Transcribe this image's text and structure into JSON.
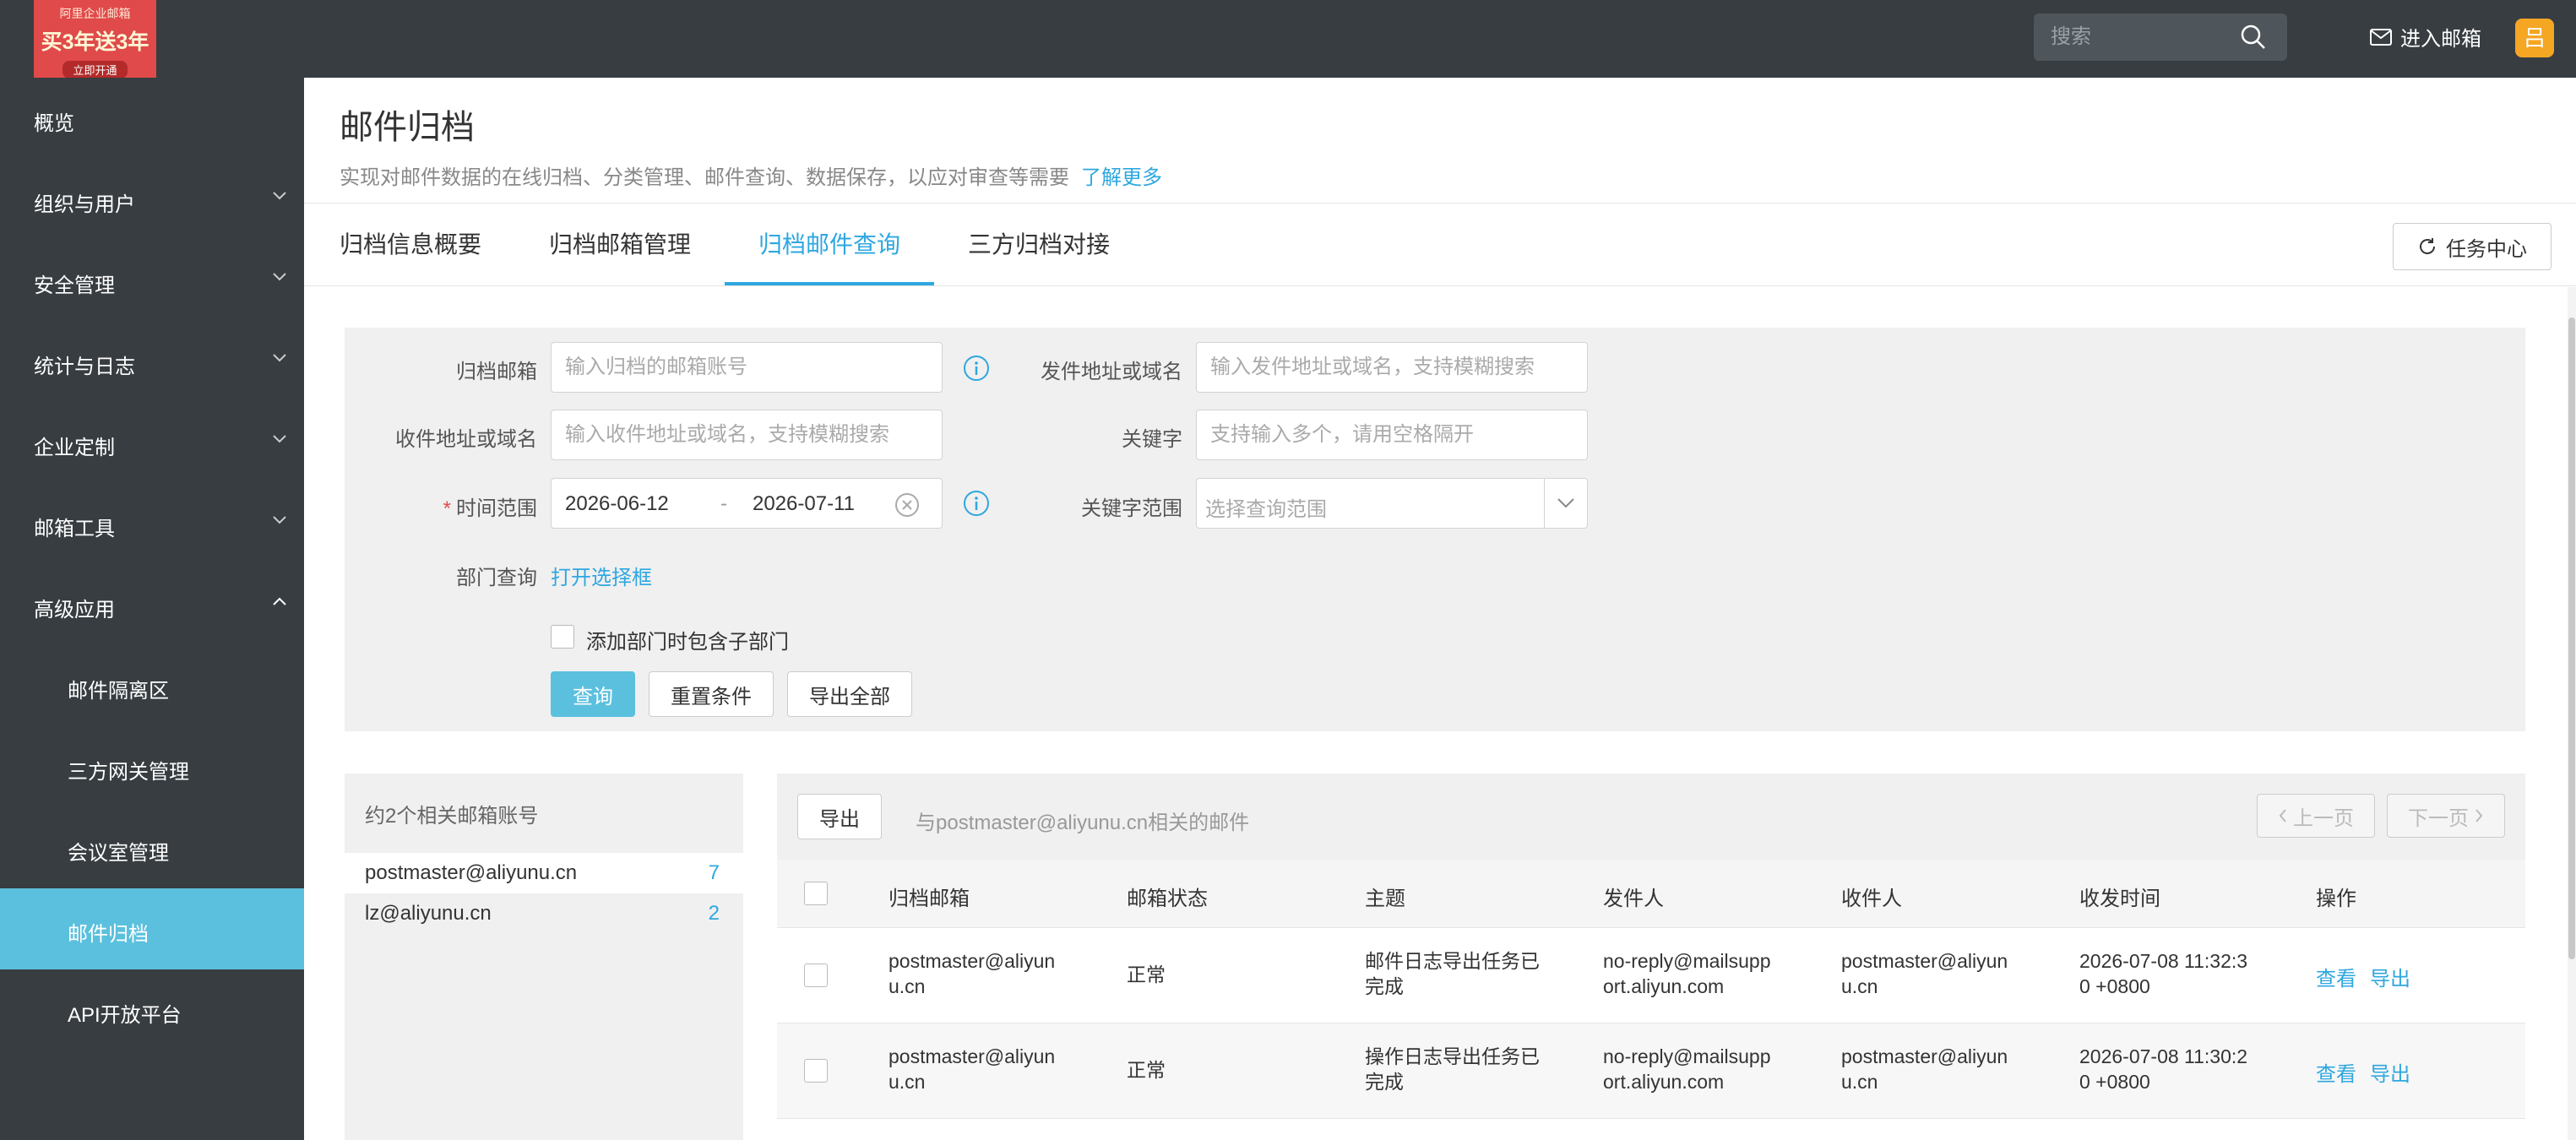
{
  "topbar": {
    "promo": {
      "line1": "阿里企业邮箱",
      "line2": "买3年送3年",
      "line3": "立即开通"
    },
    "search_placeholder": "搜索",
    "enter_mail": "进入邮箱",
    "avatar_char": "吕"
  },
  "sidebar": {
    "items": [
      {
        "label": "概览"
      },
      {
        "label": "组织与用户"
      },
      {
        "label": "安全管理"
      },
      {
        "label": "统计与日志"
      },
      {
        "label": "企业定制"
      },
      {
        "label": "邮箱工具"
      },
      {
        "label": "高级应用"
      },
      {
        "label": "邮件隔离区"
      },
      {
        "label": "三方网关管理"
      },
      {
        "label": "会议室管理"
      },
      {
        "label": "邮件归档"
      },
      {
        "label": "API开放平台"
      }
    ]
  },
  "header": {
    "title": "邮件归档",
    "description": "实现对邮件数据的在线归档、分类管理、邮件查询、数据保存，以应对审查等需要",
    "learn_more": "了解更多"
  },
  "tabs": [
    {
      "label": "归档信息概要"
    },
    {
      "label": "归档邮箱管理"
    },
    {
      "label": "归档邮件查询"
    },
    {
      "label": "三方归档对接"
    }
  ],
  "task_center": "任务中心",
  "filter": {
    "archive_mailbox": {
      "label": "归档邮箱",
      "placeholder": "输入归档的邮箱账号"
    },
    "sender": {
      "label": "发件地址或域名",
      "placeholder": "输入发件地址或域名，支持模糊搜索"
    },
    "recipient": {
      "label": "收件地址或域名",
      "placeholder": "输入收件地址或域名，支持模糊搜索"
    },
    "keyword": {
      "label": "关键字",
      "placeholder": "支持输入多个，请用空格隔开"
    },
    "time_range": {
      "required_mark": "*",
      "label": "时间范围",
      "start": "2026-06-12",
      "separator": "-",
      "end": "2026-07-11"
    },
    "keyword_scope": {
      "label": "关键字范围",
      "placeholder": "选择查询范围"
    },
    "dept": {
      "label": "部门查询",
      "link": "打开选择框"
    },
    "include_sub": "添加部门时包含子部门",
    "buttons": {
      "query": "查询",
      "reset": "重置条件",
      "export_all": "导出全部"
    }
  },
  "accounts": {
    "summary": "约2个相关邮箱账号",
    "list": [
      {
        "email": "postmaster@aliyunu.cn",
        "count": "7"
      },
      {
        "email": "lz@aliyunu.cn",
        "count": "2"
      }
    ]
  },
  "results": {
    "export": "导出",
    "description": "与postmaster@aliyunu.cn相关的邮件",
    "prev": "上一页",
    "next": "下一页",
    "columns": [
      "归档邮箱",
      "邮箱状态",
      "主题",
      "发件人",
      "收件人",
      "收发时间",
      "操作"
    ],
    "rows": [
      {
        "mailbox": [
          "postmaster@aliyun",
          "u.cn"
        ],
        "status": "正常",
        "subject": [
          "邮件日志导出任务已",
          "完成"
        ],
        "sender": [
          "no-reply@mailsupp",
          "ort.aliyun.com"
        ],
        "recipient": [
          "postmaster@aliyun",
          "u.cn"
        ],
        "time": [
          "2026-07-08 11:32:3",
          "0 +0800"
        ],
        "view": "查看",
        "export": "导出"
      },
      {
        "mailbox": [
          "postmaster@aliyun",
          "u.cn"
        ],
        "status": "正常",
        "subject": [
          "操作日志导出任务已",
          "完成"
        ],
        "sender": [
          "no-reply@mailsupp",
          "ort.aliyun.com"
        ],
        "recipient": [
          "postmaster@aliyun",
          "u.cn"
        ],
        "time": [
          "2026-07-08 11:30:2",
          "0 +0800"
        ],
        "view": "查看",
        "export": "导出"
      }
    ]
  },
  "colors": {
    "accent": "#2ea7e0",
    "sidebar": "#373d41",
    "active_nav": "#5bc0de",
    "promo": "#e04a4a",
    "avatar": "#f5a623"
  }
}
